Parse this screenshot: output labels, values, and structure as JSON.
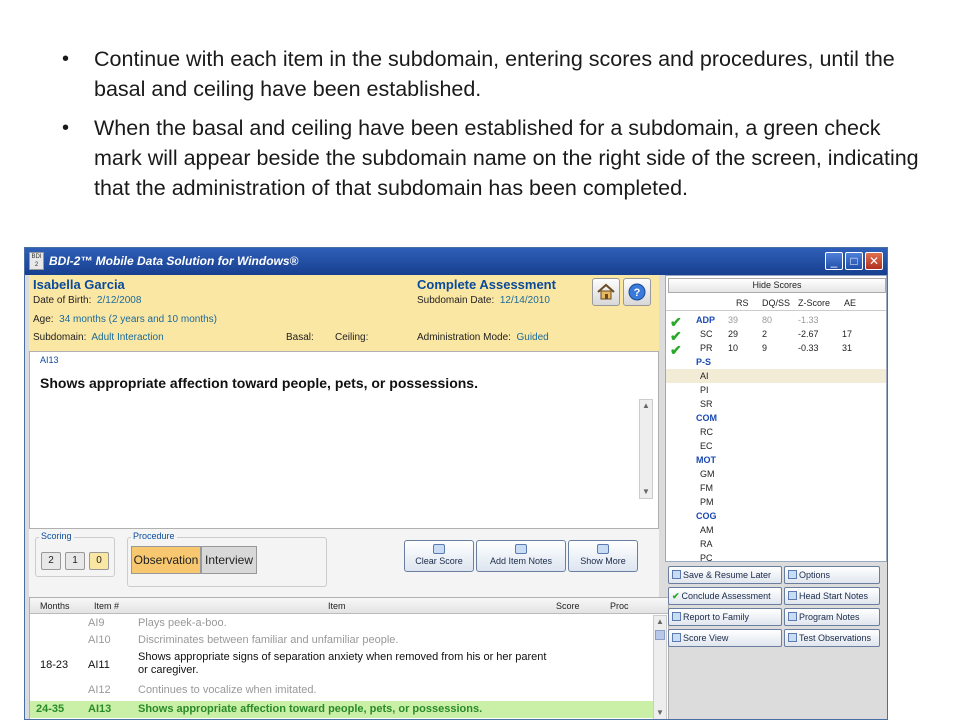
{
  "slide": {
    "bullets": [
      "Continue with each item in the subdomain, entering scores and procedures, until the basal and ceiling have been established.",
      "When the basal and ceiling have been established for a subdomain, a green check mark will appear beside the subdomain name on the right side of the screen, indicating that the administration of that subdomain has been completed."
    ],
    "bullet_glyph": "•"
  },
  "window": {
    "title": "BDI-2™ Mobile Data Solution for Windows®",
    "logo_text": "BDI 2",
    "controls": {
      "minimize": "_",
      "maximize": "□",
      "close": "✕"
    }
  },
  "header": {
    "name": "Isabella Garcia",
    "dob_label": "Date of Birth:",
    "dob_value": "2/12/2008",
    "age_label": "Age:",
    "age_value": "34 months (2 years and 10 months)",
    "subdomain_label": "Subdomain:",
    "subdomain_value": "Adult Interaction",
    "basal_label": "Basal:",
    "ceiling_label": "Ceiling:",
    "assessment_title": "Complete Assessment",
    "subdomain_date_label": "Subdomain Date:",
    "subdomain_date_value": "12/14/2010",
    "admin_mode_label": "Administration Mode:",
    "admin_mode_value": "Guided",
    "home_icon": "home-icon",
    "help_icon": "help-icon"
  },
  "item": {
    "code": "AI13",
    "text": "Shows appropriate affection toward people, pets, or possessions."
  },
  "scoring": {
    "label": "Scoring",
    "scores": [
      "2",
      "1",
      "0"
    ],
    "selected_score": "0"
  },
  "procedure": {
    "label": "Procedure",
    "options": [
      "Observation",
      "Interview"
    ],
    "selected": "Observation"
  },
  "actions": {
    "clear_score": "Clear Score",
    "add_item_notes": "Add Item Notes",
    "show_more": "Show More"
  },
  "table": {
    "headers": [
      "Months",
      "Item #",
      "Item",
      "Score",
      "Proc"
    ],
    "rows": [
      {
        "months": "",
        "item": "AI9",
        "desc": "Plays peek-a-boo.",
        "state": "gray"
      },
      {
        "months": "",
        "item": "AI10",
        "desc": "Discriminates between familiar and unfamiliar people.",
        "state": "gray"
      },
      {
        "months": "18-23",
        "item": "AI11",
        "desc": "Shows appropriate signs of separation anxiety when removed from his or her parent or caregiver.",
        "state": "normal"
      },
      {
        "months": "",
        "item": "AI12",
        "desc": "Continues to vocalize when imitated.",
        "state": "gray"
      },
      {
        "months": "24-35",
        "item": "AI13",
        "desc": "Shows appropriate affection toward people, pets, or possessions.",
        "state": "highlight"
      }
    ]
  },
  "scores": {
    "hide_label": "Hide Scores",
    "columns": [
      "RS",
      "DQ/SS",
      "Z-Score",
      "AE"
    ],
    "rows": [
      {
        "name": "ADP",
        "type": "domain",
        "check": true,
        "rs": "39",
        "ss": "80",
        "z": "-1.33",
        "ae": "",
        "gray": true
      },
      {
        "name": "SC",
        "type": "sub",
        "check": true,
        "rs": "29",
        "ss": "2",
        "z": "-2.67",
        "ae": "17"
      },
      {
        "name": "PR",
        "type": "sub",
        "check": true,
        "rs": "10",
        "ss": "9",
        "z": "-0.33",
        "ae": "31"
      },
      {
        "name": "P-S",
        "type": "domain"
      },
      {
        "name": "AI",
        "type": "sub",
        "selected": true
      },
      {
        "name": "PI",
        "type": "sub"
      },
      {
        "name": "SR",
        "type": "sub"
      },
      {
        "name": "COM",
        "type": "domain"
      },
      {
        "name": "RC",
        "type": "sub"
      },
      {
        "name": "EC",
        "type": "sub"
      },
      {
        "name": "MOT",
        "type": "domain"
      },
      {
        "name": "GM",
        "type": "sub"
      },
      {
        "name": "FM",
        "type": "sub"
      },
      {
        "name": "PM",
        "type": "sub"
      },
      {
        "name": "COG",
        "type": "domain"
      },
      {
        "name": "AM",
        "type": "sub"
      },
      {
        "name": "RA",
        "type": "sub"
      },
      {
        "name": "PC",
        "type": "sub"
      }
    ],
    "check_glyph": "✔"
  },
  "right_buttons": {
    "save_resume": "Save & Resume Later",
    "options": "Options",
    "conclude": "Conclude Assessment",
    "head_start": "Head Start Notes",
    "report_family": "Report to Family",
    "program_notes": "Program Notes",
    "score_view": "Score View",
    "test_observations": "Test Observations"
  },
  "colors": {
    "header_bg": "#fbe7a4",
    "title_blue": "#0a4a9a",
    "highlight_row": "#c9f0a6",
    "check_green": "#2aa82a",
    "selected_score": "#fbe7a4"
  }
}
